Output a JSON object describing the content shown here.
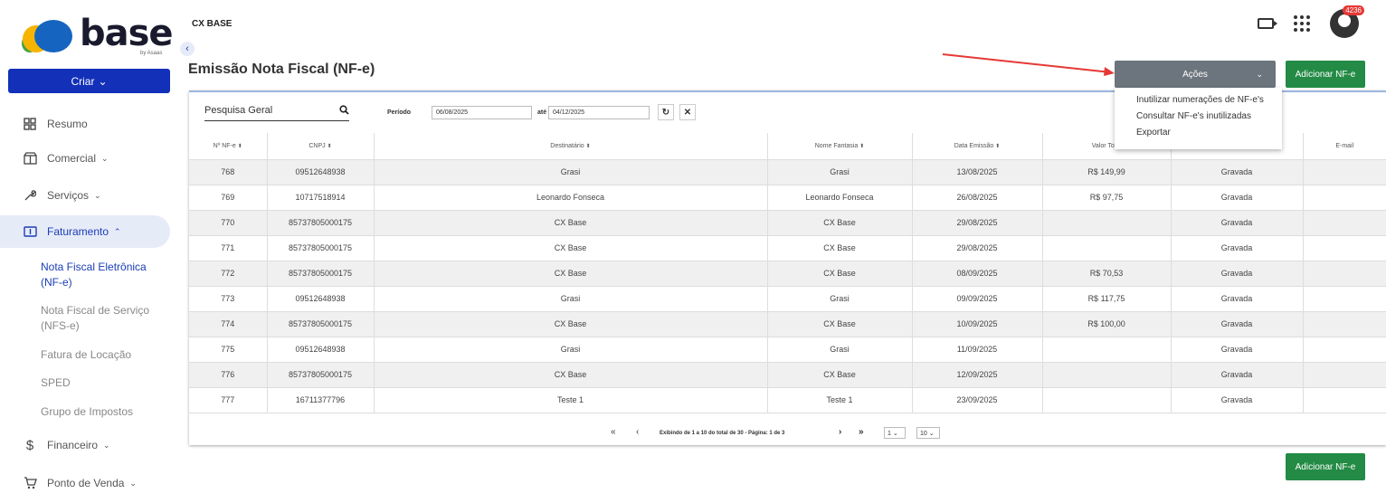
{
  "logo": {
    "word": "base",
    "tagline": "by Asaas"
  },
  "sidebar": {
    "create_label": "Criar",
    "items": [
      {
        "label": "Resumo",
        "icon": "dashboard-icon"
      },
      {
        "label": "Comercial",
        "icon": "store-icon"
      },
      {
        "label": "Serviços",
        "icon": "wrench-icon"
      },
      {
        "label": "Faturamento",
        "icon": "invoice-icon"
      },
      {
        "label": "Financeiro",
        "icon": "dollar-icon"
      },
      {
        "label": "Ponto de Venda",
        "icon": "cart-icon"
      }
    ],
    "sub_items": [
      "Nota Fiscal Eletrônica (NF-e)",
      "Nota Fiscal de Serviço (NFS-e)",
      "Fatura de Locação",
      "SPED",
      "Grupo de Impostos"
    ]
  },
  "header": {
    "app_title": "CX BASE",
    "notification_count": "4236"
  },
  "page": {
    "title": "Emissão Nota Fiscal (NF-e)",
    "actions_label": "Ações",
    "add_label": "Adicionar NF-e",
    "dropdown": [
      "Inutilizar numerações de NF-e's",
      "Consultar NF-e's inutilizadas",
      "Exportar"
    ]
  },
  "filters": {
    "search_label": "Pesquisa Geral",
    "period_label": "Período",
    "date_from": "06/08/2025",
    "until_label": "até",
    "date_to": "04/12/2025"
  },
  "table": {
    "headers": [
      "Nº NF-e",
      "CNPJ",
      "Destinatário",
      "Nome Fantasia",
      "Data Emissão",
      "Valor Total",
      "",
      "E-mail"
    ],
    "rows": [
      [
        "768",
        "09512648938",
        "Grasi",
        "Grasi",
        "13/08/2025",
        "R$ 149,99",
        "Gravada",
        ""
      ],
      [
        "769",
        "10717518914",
        "Leonardo Fonseca",
        "Leonardo Fonseca",
        "26/08/2025",
        "R$ 97,75",
        "Gravada",
        ""
      ],
      [
        "770",
        "85737805000175",
        "CX Base",
        "CX Base",
        "29/08/2025",
        "",
        "Gravada",
        ""
      ],
      [
        "771",
        "85737805000175",
        "CX Base",
        "CX Base",
        "29/08/2025",
        "",
        "Gravada",
        ""
      ],
      [
        "772",
        "85737805000175",
        "CX Base",
        "CX Base",
        "08/09/2025",
        "R$ 70,53",
        "Gravada",
        ""
      ],
      [
        "773",
        "09512648938",
        "Grasi",
        "Grasi",
        "09/09/2025",
        "R$ 117,75",
        "Gravada",
        ""
      ],
      [
        "774",
        "85737805000175",
        "CX Base",
        "CX Base",
        "10/09/2025",
        "R$ 100,00",
        "Gravada",
        ""
      ],
      [
        "775",
        "09512648938",
        "Grasi",
        "Grasi",
        "11/09/2025",
        "",
        "Gravada",
        ""
      ],
      [
        "776",
        "85737805000175",
        "CX Base",
        "CX Base",
        "12/09/2025",
        "",
        "Gravada",
        ""
      ],
      [
        "777",
        "16711377796",
        "Teste 1",
        "Teste 1",
        "23/09/2025",
        "",
        "Gravada",
        ""
      ]
    ]
  },
  "pager": {
    "text": "Exibindo de 1 a 10 do total de 30 - Página: 1 de 3",
    "page": "1",
    "per_page": "10"
  },
  "colors": {
    "primary": "#1330b9",
    "success": "#238b45",
    "actions": "#6c757d"
  }
}
